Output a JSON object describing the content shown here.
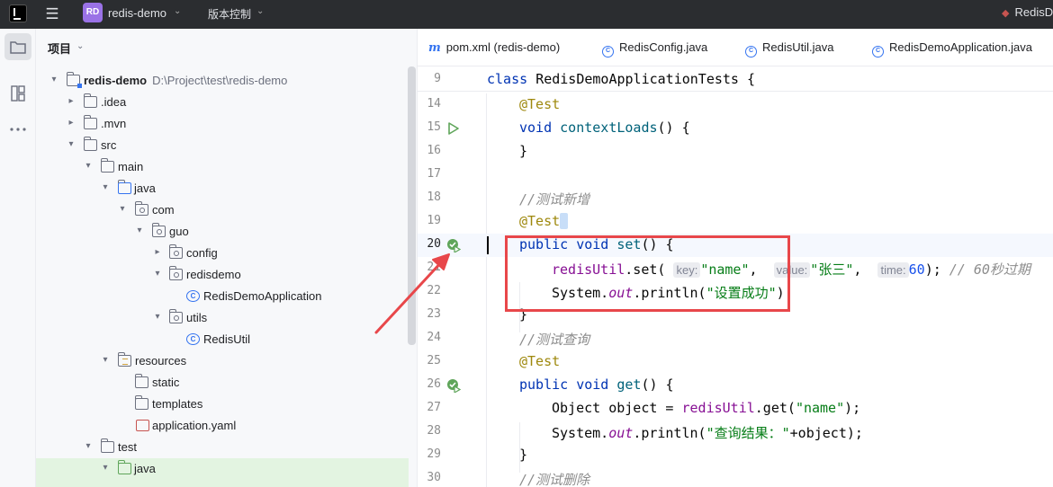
{
  "titlebar": {
    "project_badge": "RD",
    "project_name": "redis-demo",
    "vcs_label": "版本控制",
    "run_config": "RedisDemoApplicationTests"
  },
  "toolstrip": {
    "icons": [
      "folder-icon",
      "structure-icon",
      "more-icon"
    ]
  },
  "project_pane": {
    "header": "项目",
    "tree": [
      {
        "label": "redis-demo",
        "hint": "D:\\Project\\test\\redis-demo",
        "icon": "module-folder-icon"
      },
      {
        "label": ".idea",
        "icon": "folder-icon"
      },
      {
        "label": ".mvn",
        "icon": "folder-icon"
      },
      {
        "label": "src",
        "icon": "folder-icon"
      },
      {
        "label": "main",
        "icon": "folder-icon"
      },
      {
        "label": "java",
        "icon": "source-folder-icon"
      },
      {
        "label": "com",
        "icon": "package-icon"
      },
      {
        "label": "guo",
        "icon": "package-icon"
      },
      {
        "label": "config",
        "icon": "package-icon"
      },
      {
        "label": "redisdemo",
        "icon": "package-icon"
      },
      {
        "label": "RedisDemoApplication",
        "icon": "spring-class-icon"
      },
      {
        "label": "utils",
        "icon": "package-icon"
      },
      {
        "label": "RedisUtil",
        "icon": "class-icon"
      },
      {
        "label": "resources",
        "icon": "resources-folder-icon"
      },
      {
        "label": "static",
        "icon": "folder-icon"
      },
      {
        "label": "templates",
        "icon": "folder-icon"
      },
      {
        "label": "application.yaml",
        "icon": "yaml-file-icon"
      },
      {
        "label": "test",
        "icon": "folder-icon"
      },
      {
        "label": "java",
        "icon": "test-source-folder-icon"
      }
    ]
  },
  "editor": {
    "tabs": [
      {
        "label": "pom.xml (redis-demo)",
        "icon": "maven-icon"
      },
      {
        "label": "RedisConfig.java",
        "icon": "class-icon"
      },
      {
        "label": "RedisUtil.java",
        "icon": "class-icon"
      },
      {
        "label": "RedisDemoApplication.java",
        "icon": "spring-class-icon"
      }
    ],
    "sticky": {
      "line_number": "9",
      "text": "class RedisDemoApplicationTests {"
    },
    "lines": [
      {
        "n": "14",
        "text": "@Test"
      },
      {
        "n": "15",
        "text": "void contextLoads() {"
      },
      {
        "n": "16",
        "text": "}"
      },
      {
        "n": "17",
        "text": ""
      },
      {
        "n": "18",
        "text": "//测试新增"
      },
      {
        "n": "19",
        "text": "@Test"
      },
      {
        "n": "20",
        "text": "public void set() {"
      },
      {
        "n": "21",
        "text": "redisUtil.set( key: \"name\",  value: \"张三\",  time: 60); // 60秒过期"
      },
      {
        "n": "22",
        "text": "System.out.println(\"设置成功\")"
      },
      {
        "n": "23",
        "text": "}"
      },
      {
        "n": "24",
        "text": "//测试查询"
      },
      {
        "n": "25",
        "text": "@Test"
      },
      {
        "n": "26",
        "text": "public void get() {"
      },
      {
        "n": "27",
        "text": "Object object = redisUtil.get(\"name\");"
      },
      {
        "n": "28",
        "text": "System.out.println(\"查询结果：\"+object);"
      },
      {
        "n": "29",
        "text": "}"
      },
      {
        "n": "30",
        "text": "//测试删除"
      }
    ],
    "tokens": {
      "l14_ann": "@Test",
      "l15_kw": "void",
      "l15_fn": "contextLoads",
      "l15_rest": "() {",
      "l16": "}",
      "l18_cm": "//测试新增",
      "l19_ann": "@Test",
      "l20_kw1": "public",
      "l20_kw2": "void",
      "l20_fn": "set",
      "l20_rest": "() {",
      "l21_fld": "redisUtil",
      "l21_call": ".set(",
      "l21_hint_key": "key:",
      "l21_str1": "\"name\"",
      "l21_c1": ",",
      "l21_hint_value": "value:",
      "l21_str2": "\"张三\"",
      "l21_c2": ",",
      "l21_hint_time": "time:",
      "l21_num": "60",
      "l21_end": ");",
      "l21_cm": "// 60秒过期",
      "l22_sys": "System.",
      "l22_out": "out",
      "l22_call": ".println(",
      "l22_str": "\"设置成功\"",
      "l22_end": ")",
      "l23": "}",
      "l24_cm": "//测试查询",
      "l25_ann": "@Test",
      "l26_kw1": "public",
      "l26_kw2": "void",
      "l26_fn": "get",
      "l26_rest": "() {",
      "l27_a": "Object object = ",
      "l27_fld": "redisUtil",
      "l27_call": ".get(",
      "l27_str": "\"name\"",
      "l27_end": ");",
      "l28_sys": "System.",
      "l28_out": "out",
      "l28_call": ".println(",
      "l28_str": "\"查询结果：\"",
      "l28_end": "+object);",
      "l29": "}",
      "l30_cm": "//测试删除"
    }
  },
  "colors": {
    "annotation_box": "#e8474a",
    "run_gutter": "#5fa55a",
    "accent": "#3574f0"
  }
}
